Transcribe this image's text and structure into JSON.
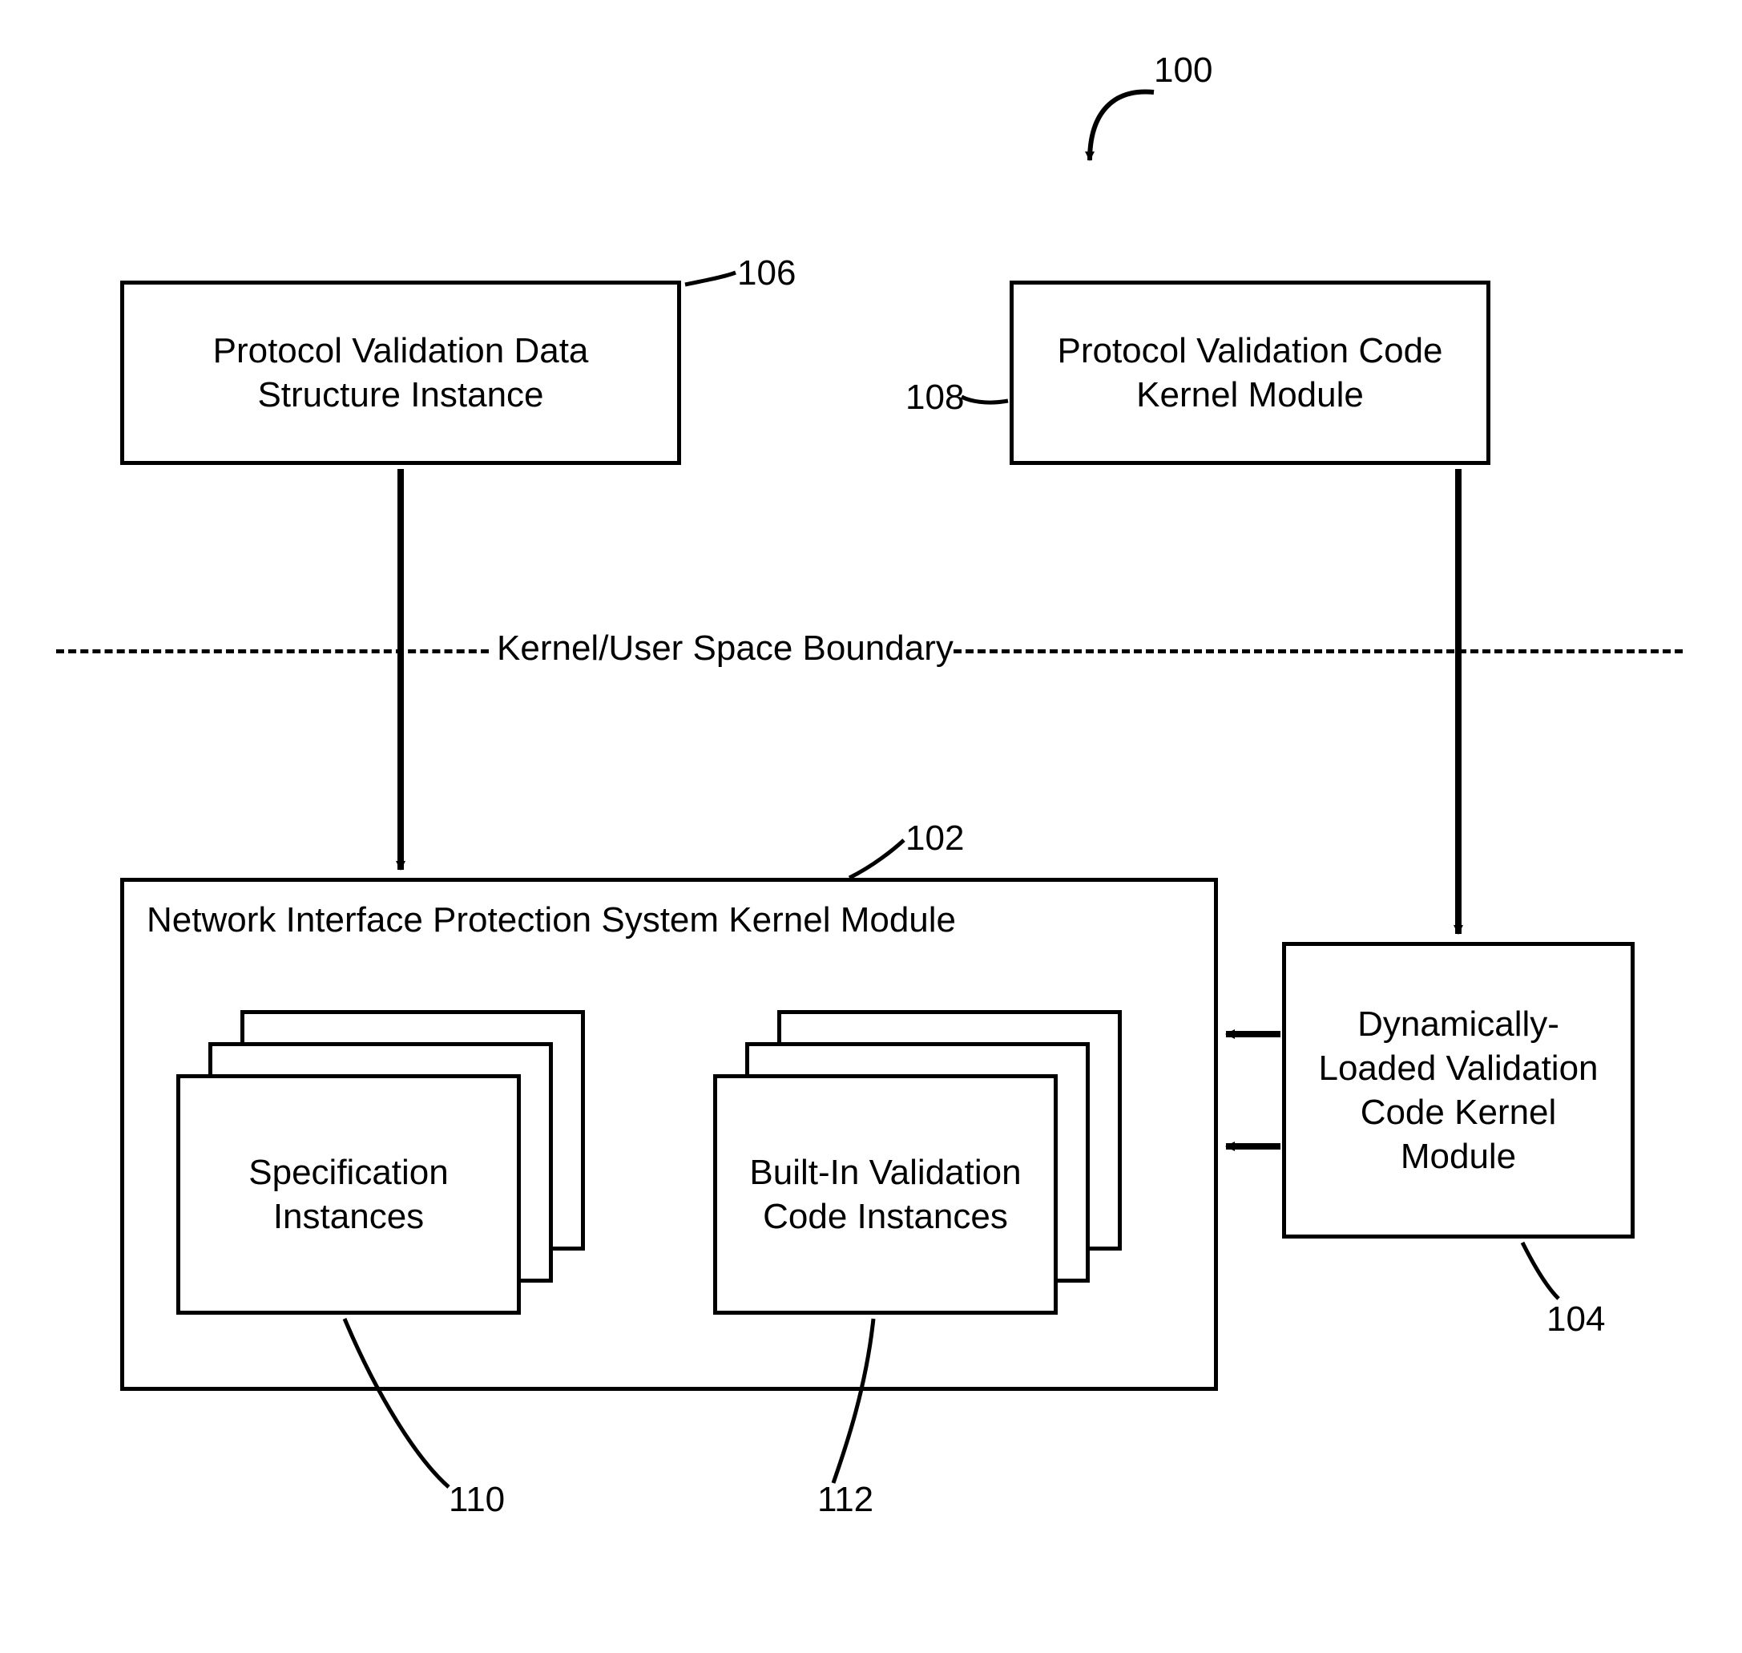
{
  "refs": {
    "overall": "100",
    "nips": "102",
    "dyn": "104",
    "pvds": "106",
    "pvck": "108",
    "spec": "110",
    "builtin": "112"
  },
  "boxes": {
    "pvds": "Protocol Validation Data Structure Instance",
    "pvck": "Protocol Validation Code Kernel Module",
    "nips_title": "Network Interface Protection System Kernel Module",
    "dyn": "Dynamically-Loaded Validation Code Kernel Module",
    "spec": "Specification Instances",
    "builtin": "Built-In Validation Code Instances"
  },
  "labels": {
    "boundary": "Kernel/User Space Boundary"
  }
}
